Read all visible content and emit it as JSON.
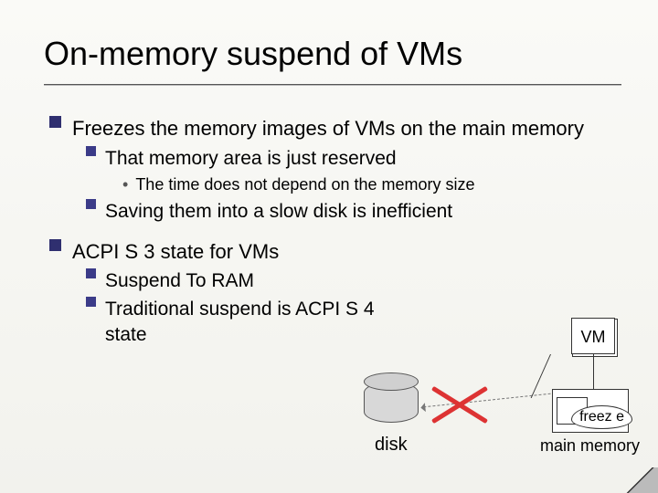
{
  "title": "On-memory suspend of VMs",
  "p1": "Freezes the memory images of VMs on the main memory",
  "p1a": "That memory area is just reserved",
  "p1a1": "The time does not depend on the memory size",
  "p1b": "Saving them into a slow disk is inefficient",
  "p2": "ACPI S 3 state for VMs",
  "p2a": "Suspend To RAM",
  "p2b": "Traditional suspend is ACPI S 4 state",
  "diagram": {
    "vm": "VM",
    "disk": "disk",
    "mem": "main memory",
    "freeze": "freez\ne"
  }
}
